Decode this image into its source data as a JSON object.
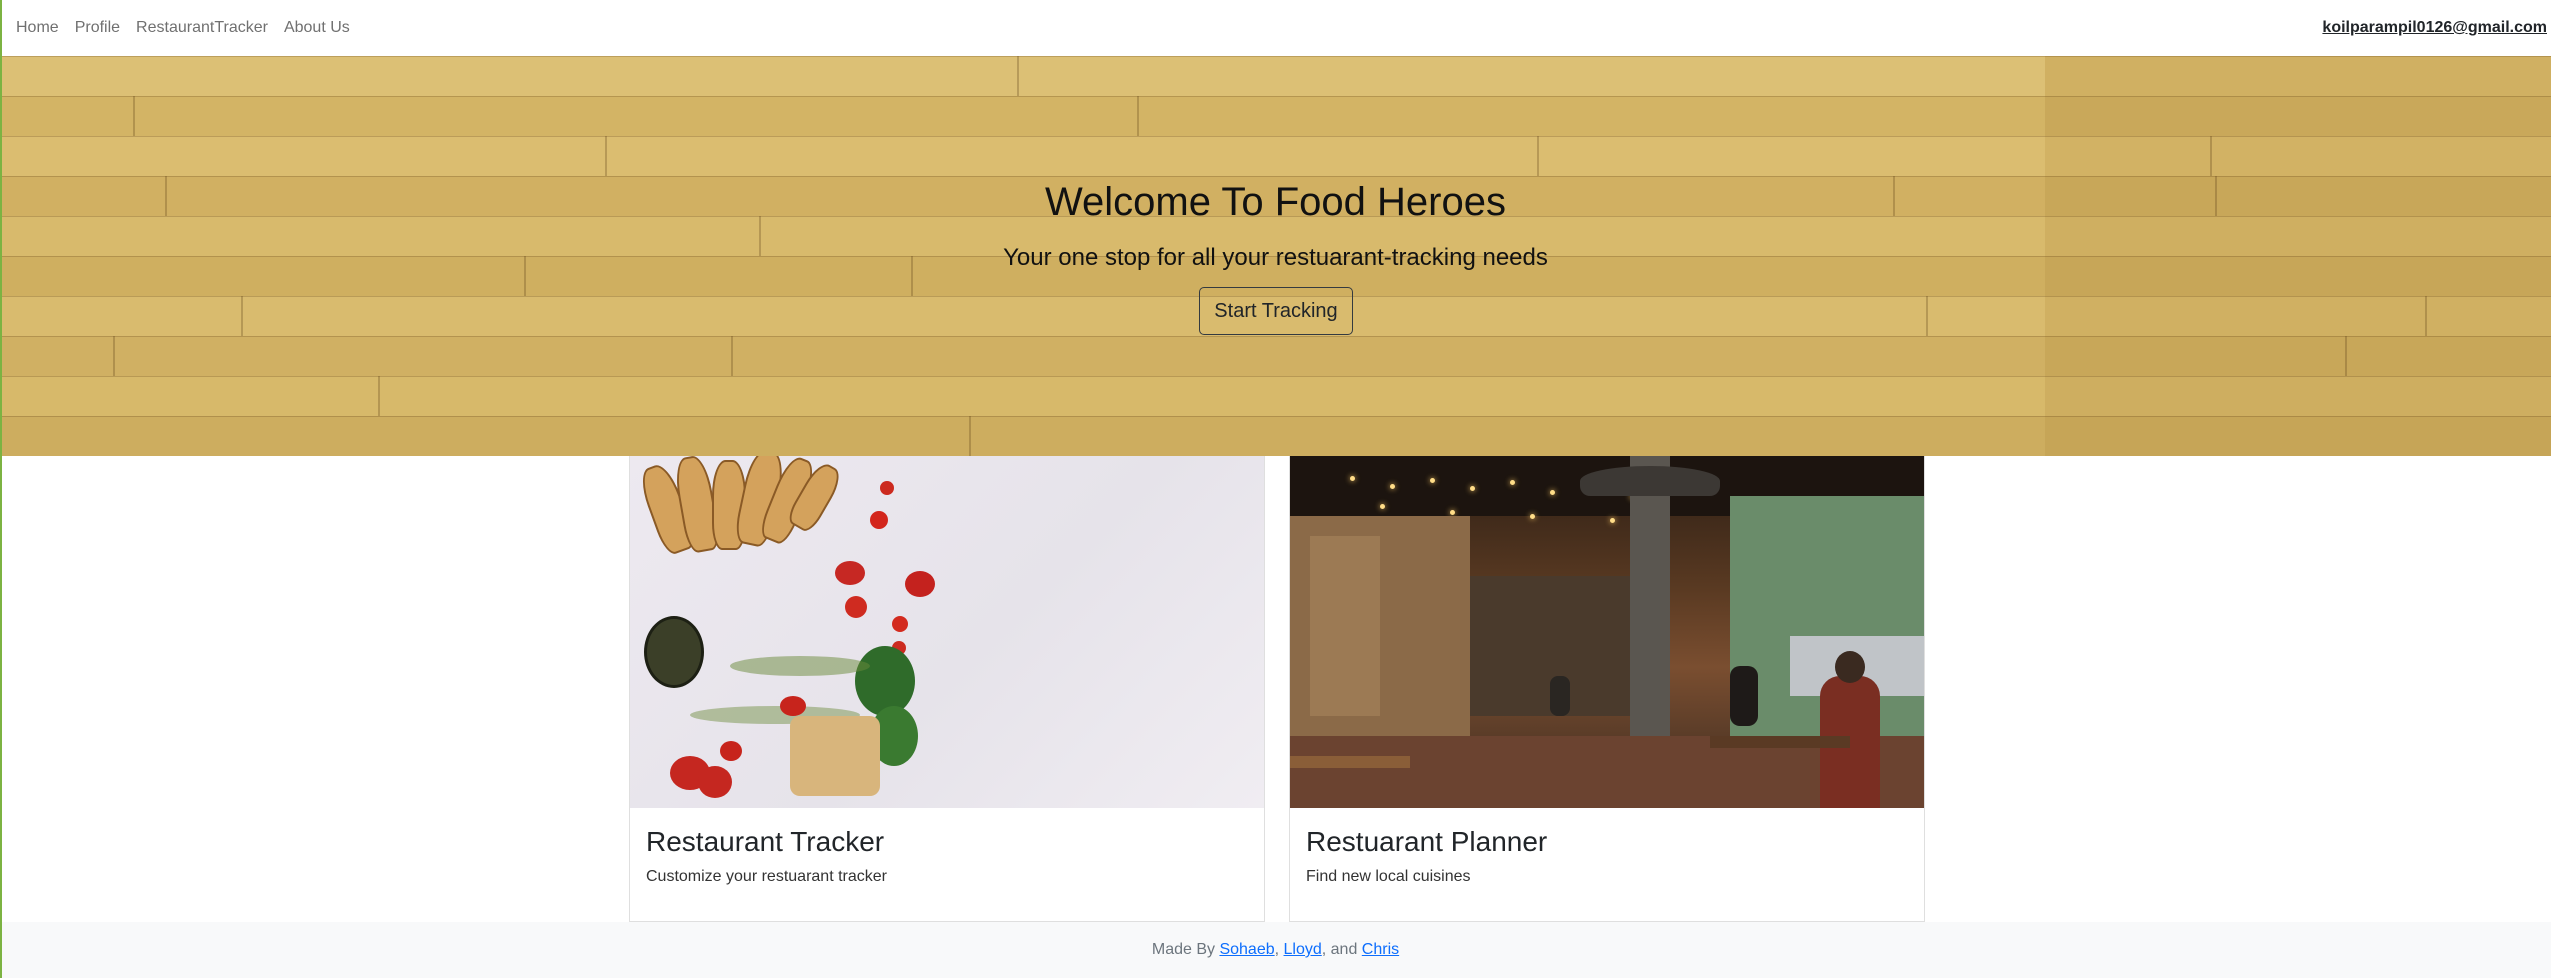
{
  "nav": {
    "links": [
      "Home",
      "Profile",
      "RestaurantTracker",
      "About Us"
    ],
    "user_email": "koilparampil0126@gmail.com"
  },
  "hero": {
    "title": "Welcome To Food Heroes",
    "subtitle": "Your one stop for all your restuarant-tracking needs",
    "button_label": "Start Tracking"
  },
  "cards": [
    {
      "title": "Restaurant Tracker",
      "text": "Customize your restuarant tracker"
    },
    {
      "title": "Restuarant Planner",
      "text": "Find new local cuisines"
    }
  ],
  "footer": {
    "prefix": "Made By ",
    "authors": [
      "Sohaeb",
      "Lloyd",
      "Chris"
    ],
    "sep1": ", ",
    "sep2": ", and "
  },
  "colors": {
    "accent_line": "#7cb342",
    "link": "#0d6efd",
    "wood": "#d6b86c"
  }
}
